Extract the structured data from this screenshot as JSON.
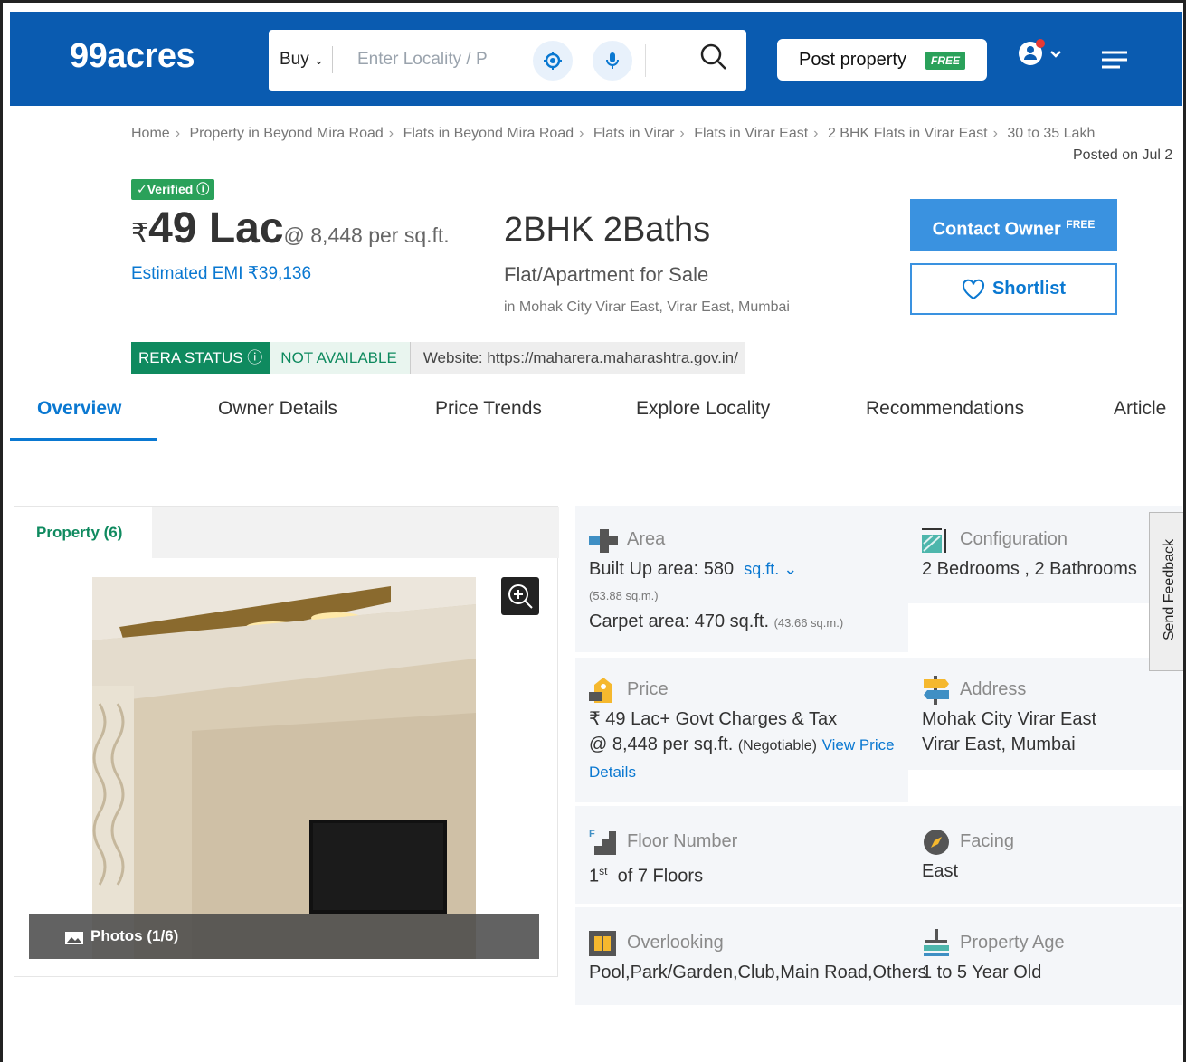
{
  "header": {
    "logo": "99acres",
    "buy_label": "Buy",
    "search_placeholder": "Enter Locality / P",
    "post_property_label": "Post property",
    "post_free_badge": "FREE"
  },
  "breadcrumb": {
    "items": [
      "Home",
      "Property in Beyond Mira Road",
      "Flats in Beyond Mira Road",
      "Flats in Virar",
      "Flats in Virar East",
      "2 BHK Flats in Virar East",
      "30 to 35 Lakh"
    ],
    "posted": "Posted on Jul 2"
  },
  "listing": {
    "verified": "Verified",
    "rupee": "₹",
    "price": "49 Lac",
    "per_sqft": "@ 8,448 per sq.ft.",
    "emi": "Estimated EMI ₹39,136",
    "bhk": "2BHK 2Baths",
    "type": "Flat/Apartment for Sale",
    "location": "in Mohak City Virar East, Virar East, Mumbai",
    "contact_label": "Contact Owner",
    "contact_free": "FREE",
    "shortlist_label": "Shortlist",
    "rera_status": "RERA STATUS",
    "rera_value": "NOT AVAILABLE",
    "rera_website": "Website: https://maharera.maharashtra.gov.in/"
  },
  "tabs": [
    "Overview",
    "Owner Details",
    "Price Trends",
    "Explore Locality",
    "Recommendations",
    "Article"
  ],
  "gallery": {
    "tab_label": "Property (6)",
    "photos_label": "Photos (1/6)"
  },
  "details": {
    "area_title": "Area",
    "area_builtup": "Built Up area: 580",
    "area_unit": "sq.ft.",
    "area_builtup_sqm": "(53.88 sq.m.)",
    "area_carpet": "Carpet area: 470 sq.ft.",
    "area_carpet_sqm": "(43.66 sq.m.)",
    "config_title": "Configuration",
    "config_value": "2 Bedrooms , 2 Bathrooms",
    "price_title": "Price",
    "price_value": "₹ 49 Lac+ Govt Charges & Tax",
    "price_rate": "@ 8,448 per sq.ft.",
    "price_negotiable": "(Negotiable)",
    "price_link_1": "View Price",
    "price_link_2": "Details",
    "address_title": "Address",
    "address_line1": "Mohak City Virar East",
    "address_line2": "Virar East, Mumbai",
    "floor_title": "Floor Number",
    "floor_num": "1",
    "floor_sup": "st",
    "floor_value": "of 7 Floors",
    "facing_title": "Facing",
    "facing_value": "East",
    "overlooking_title": "Overlooking",
    "overlooking_value": "Pool,Park/Garden,Club,Main Road,Others",
    "age_title": "Property Age",
    "age_value": "1 to 5 Year Old"
  },
  "feedback_label": "Send Feedback",
  "colors": {
    "header_bg": "#0a5bb0",
    "accent": "#0a78d1",
    "green": "#0f8a5f"
  }
}
